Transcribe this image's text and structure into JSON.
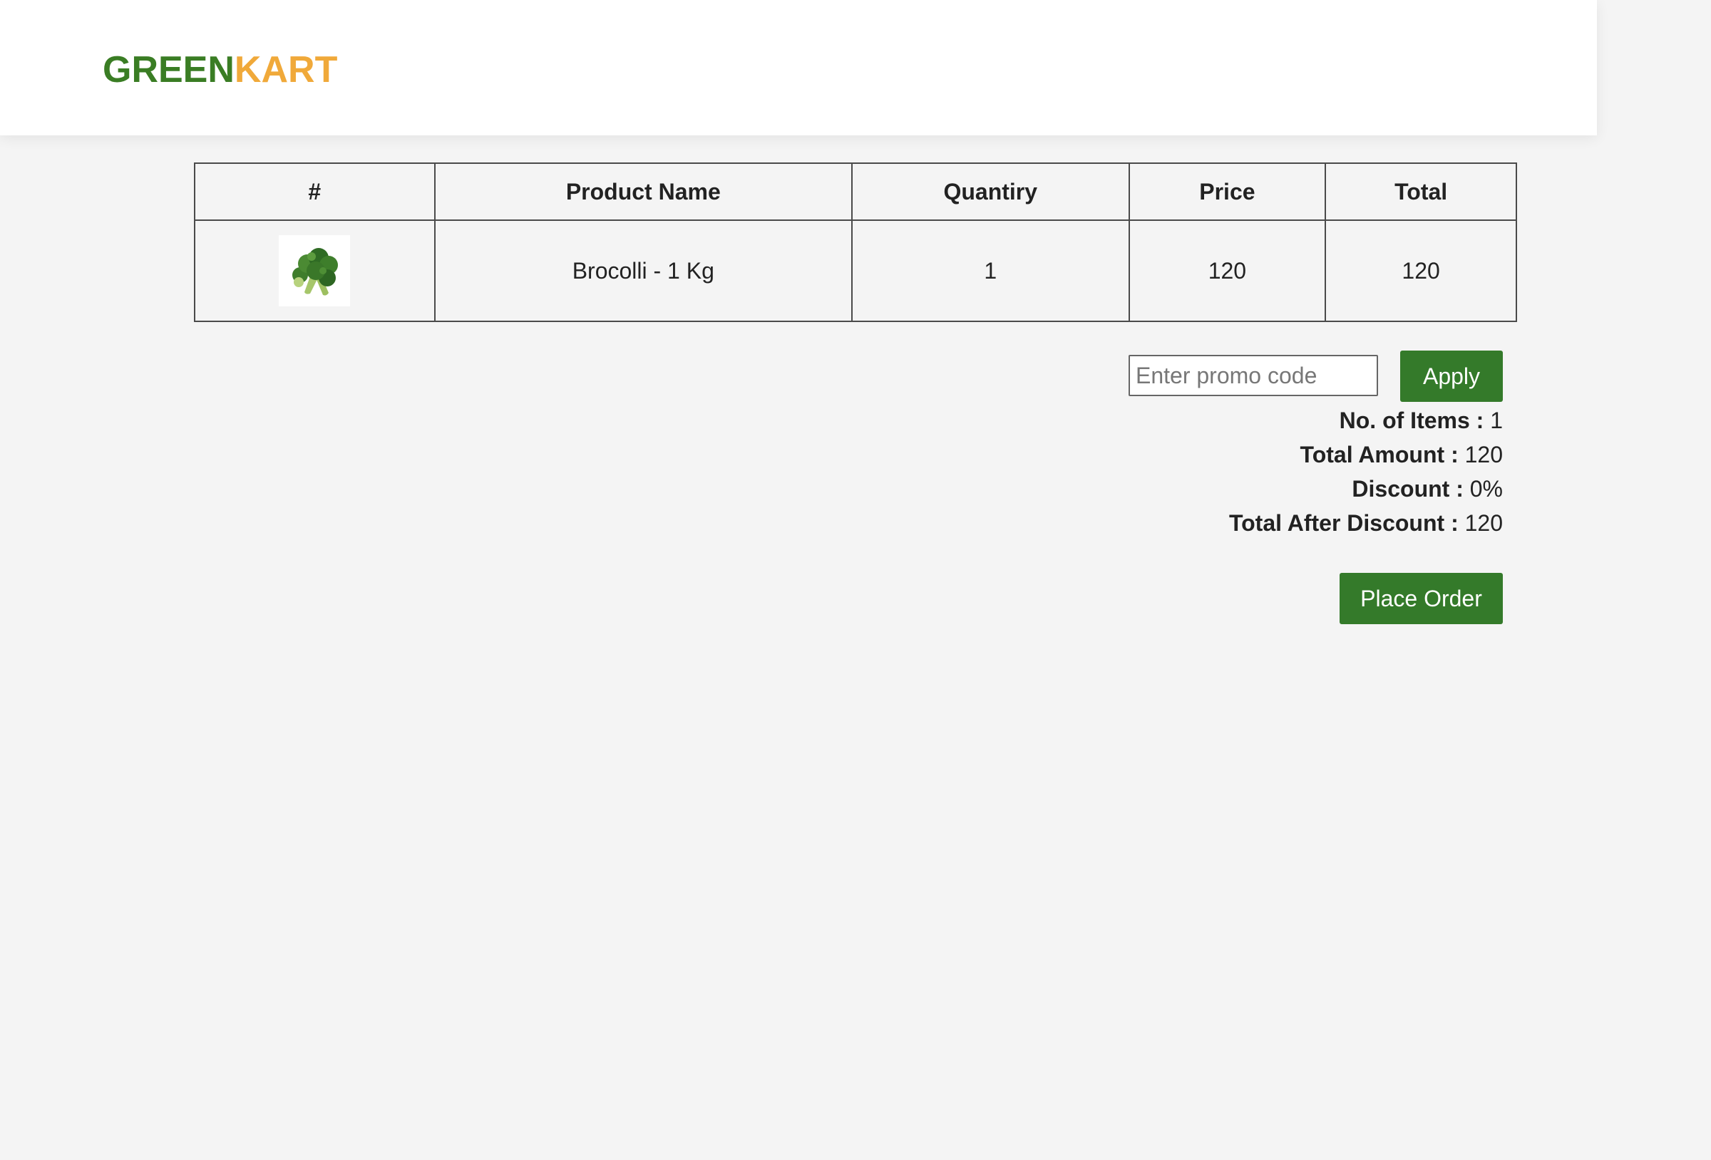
{
  "brand": {
    "part1": "GREEN",
    "part2": "KART",
    "colors": {
      "green": "#3a7d24",
      "orange": "#f0a93a"
    }
  },
  "cart_table": {
    "headers": {
      "index": "#",
      "product_name": "Product Name",
      "quantity": "Quantiry",
      "price": "Price",
      "total": "Total"
    },
    "rows": [
      {
        "image_icon": "broccoli-icon",
        "product_name": "Brocolli - 1 Kg",
        "quantity": "1",
        "price": "120",
        "total": "120"
      }
    ]
  },
  "promo": {
    "value": "",
    "placeholder": "Enter promo code",
    "apply_label": "Apply"
  },
  "summary": {
    "items_label": "No. of Items :",
    "items_value": "1",
    "amount_label": "Total Amount :",
    "amount_value": "120",
    "discount_label": "Discount :",
    "discount_value": "0%",
    "after_label": "Total After Discount :",
    "after_value": "120"
  },
  "actions": {
    "place_order_label": "Place Order",
    "button_color": "#347a2a"
  }
}
